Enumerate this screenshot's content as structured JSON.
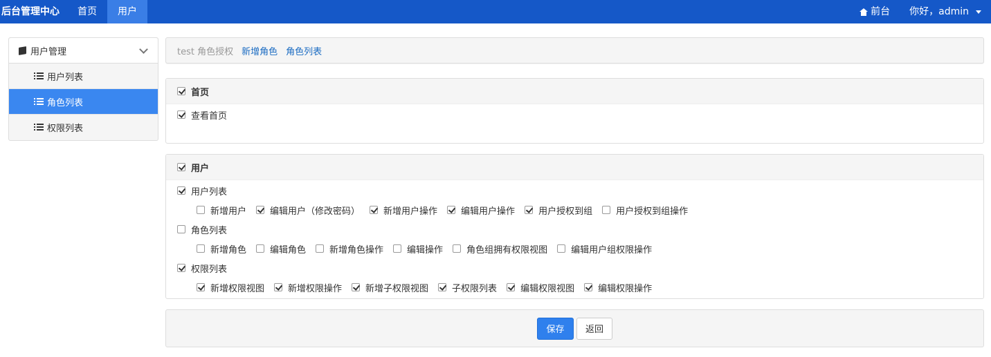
{
  "navbar": {
    "brand": "后台管理中心",
    "links": [
      {
        "label": "首页",
        "active": false
      },
      {
        "label": "用户",
        "active": true
      }
    ],
    "front": "前台",
    "user": "你好，admin"
  },
  "sidebar": {
    "title": "用户管理",
    "items": [
      {
        "label": "用户列表",
        "active": false
      },
      {
        "label": "角色列表",
        "active": true
      },
      {
        "label": "权限列表",
        "active": false
      }
    ]
  },
  "breadcrumb": {
    "current": "test 角色授权",
    "links": [
      "新增角色",
      "角色列表"
    ]
  },
  "panels": [
    {
      "title": "首页",
      "checked": true,
      "groups": [
        {
          "label": "查看首页",
          "checked": true,
          "options": []
        }
      ]
    },
    {
      "title": "用户",
      "checked": true,
      "groups": [
        {
          "label": "用户列表",
          "checked": true,
          "options": [
            {
              "label": "新增用户",
              "checked": false
            },
            {
              "label": "编辑用户（修改密码）",
              "checked": true
            },
            {
              "label": "新增用户操作",
              "checked": true
            },
            {
              "label": "编辑用户操作",
              "checked": true
            },
            {
              "label": "用户授权到组",
              "checked": true
            },
            {
              "label": "用户授权到组操作",
              "checked": false
            }
          ]
        },
        {
          "label": "角色列表",
          "checked": false,
          "options": [
            {
              "label": "新增角色",
              "checked": false
            },
            {
              "label": "编辑角色",
              "checked": false
            },
            {
              "label": "新增角色操作",
              "checked": false
            },
            {
              "label": "编辑操作",
              "checked": false
            },
            {
              "label": "角色组拥有权限视图",
              "checked": false
            },
            {
              "label": "编辑用户组权限操作",
              "checked": false
            }
          ]
        },
        {
          "label": "权限列表",
          "checked": true,
          "options": [
            {
              "label": "新增权限视图",
              "checked": true
            },
            {
              "label": "新增权限操作",
              "checked": true
            },
            {
              "label": "新增子权限视图",
              "checked": true
            },
            {
              "label": "子权限列表",
              "checked": true
            },
            {
              "label": "编辑权限视图",
              "checked": true
            },
            {
              "label": "编辑权限操作",
              "checked": true
            }
          ]
        }
      ]
    }
  ],
  "footer": {
    "save": "保存",
    "back": "返回"
  }
}
